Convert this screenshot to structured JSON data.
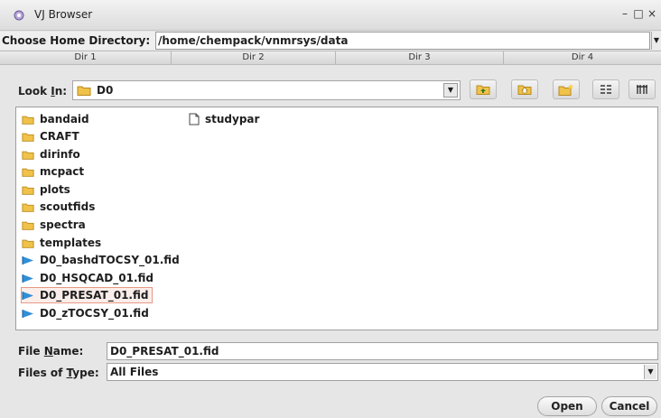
{
  "window": {
    "title": "VJ Browser",
    "controls": [
      "–",
      "□",
      "×"
    ]
  },
  "home": {
    "label": "Choose Home Directory:",
    "path": "/home/chempack/vnmrsys/data"
  },
  "dir_tabs": [
    "Dir 1",
    "Dir 2",
    "Dir 3",
    "Dir 4"
  ],
  "lookin": {
    "label_prefix": "Look ",
    "label_mnemonic": "I",
    "label_suffix": "n:",
    "value": "D0"
  },
  "toolbar": {
    "icons": [
      "up-folder-icon",
      "home-icon",
      "new-folder-icon",
      "list-view-icon",
      "details-view-icon"
    ]
  },
  "files": [
    {
      "name": "bandaid",
      "type": "folder"
    },
    {
      "name": "CRAFT",
      "type": "folder"
    },
    {
      "name": "dirinfo",
      "type": "folder"
    },
    {
      "name": "mcpact",
      "type": "folder"
    },
    {
      "name": "plots",
      "type": "folder"
    },
    {
      "name": "scoutfids",
      "type": "folder"
    },
    {
      "name": "spectra",
      "type": "folder"
    },
    {
      "name": "templates",
      "type": "folder"
    },
    {
      "name": "D0_bashdTOCSY_01.fid",
      "type": "fid"
    },
    {
      "name": "D0_HSQCAD_01.fid",
      "type": "fid"
    },
    {
      "name": "D0_PRESAT_01.fid",
      "type": "fid",
      "selected": true
    },
    {
      "name": "D0_zTOCSY_01.fid",
      "type": "fid"
    },
    {
      "name": "studypar",
      "type": "file"
    }
  ],
  "filename": {
    "label_prefix": "File ",
    "label_mnemonic": "N",
    "label_suffix": "ame:",
    "value": "D0_PRESAT_01.fid"
  },
  "filetype": {
    "label_prefix": "Files of ",
    "label_mnemonic": "T",
    "label_suffix": "ype:",
    "value": "All Files"
  },
  "buttons": {
    "open": "Open",
    "cancel": "Cancel"
  },
  "colors": {
    "folder": "#f0c24a",
    "fid": "#2f8fd8",
    "selection_border": "#e59a86"
  }
}
